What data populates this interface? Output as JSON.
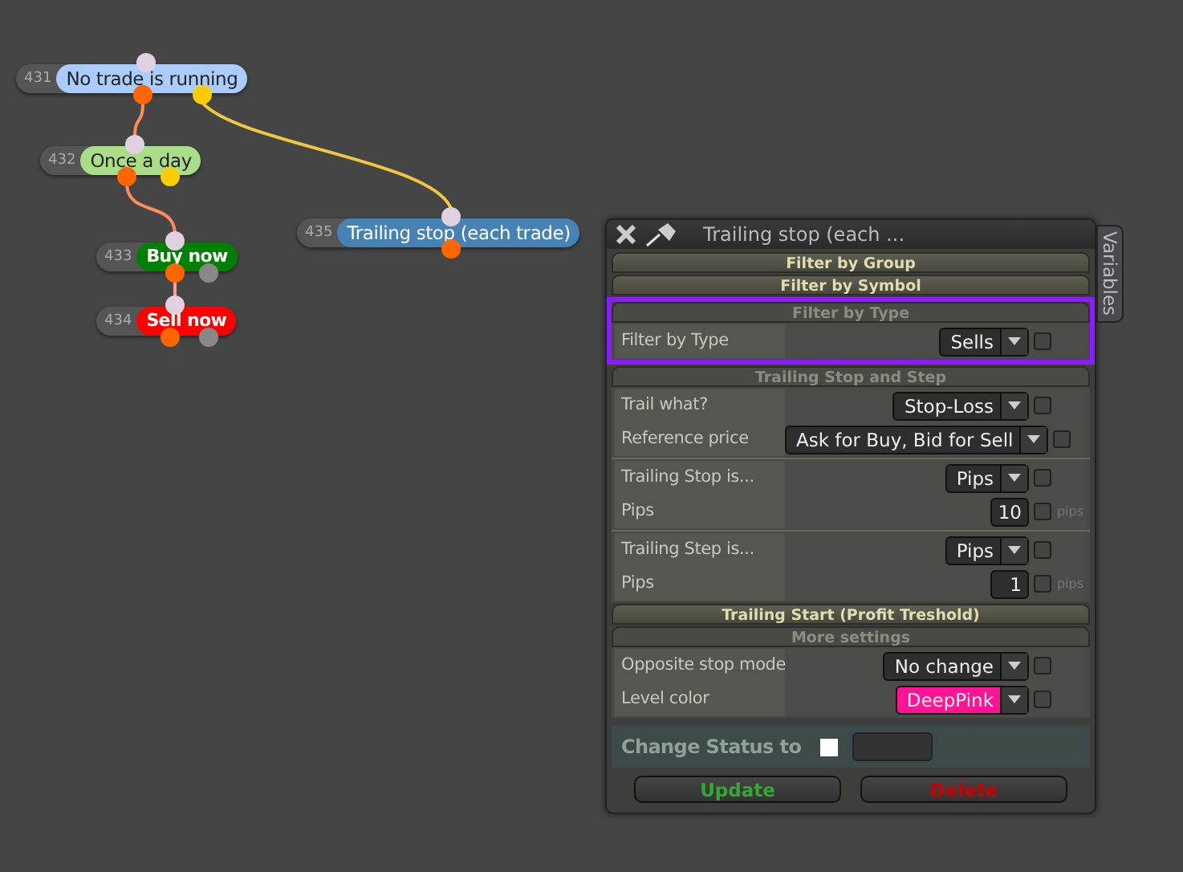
{
  "nodes": [
    {
      "number": "431",
      "label": "No trade is running",
      "color": "#aaccff",
      "outputs": [
        {
          "color": "#ff6600"
        },
        {
          "color": "#ffcc00"
        }
      ]
    },
    {
      "number": "432",
      "label": "Once a day",
      "color": "#aadd88",
      "outputs": [
        {
          "color": "#ff6600"
        },
        {
          "color": "#ffcc00"
        }
      ]
    },
    {
      "number": "433",
      "label": "Buy now",
      "color": "#008000",
      "outputs": [
        {
          "color": "#ff6600"
        },
        {
          "color": "#888888"
        }
      ]
    },
    {
      "number": "434",
      "label": "Sell now",
      "color": "#ff0000",
      "outputs": [
        {
          "color": "#ff6600"
        },
        {
          "color": "#888888"
        }
      ]
    },
    {
      "number": "435",
      "label": "Trailing stop (each trade)",
      "color": "#4682b4",
      "outputs": [
        {
          "color": "#ff6600"
        }
      ]
    }
  ],
  "panel": {
    "title": "Trailing stop (each ...",
    "side_tab": "Variables",
    "sections": [
      {
        "title": "Filter by Group",
        "expanded": false,
        "highlighted": false
      },
      {
        "title": "Filter by Symbol",
        "expanded": false,
        "highlighted": false
      },
      {
        "title": "Filter by Type",
        "expanded": true,
        "highlighted": true,
        "groups": [
          {
            "rows": [
              {
                "kind": "select",
                "label": "Filter by Type",
                "value": "Sells",
                "checked": false
              }
            ]
          }
        ]
      },
      {
        "title": "Trailing Stop and Step",
        "expanded": true,
        "highlighted": false,
        "groups": [
          {
            "rows": [
              {
                "kind": "select",
                "label": "Trail what?",
                "value": "Stop-Loss",
                "checked": false
              },
              {
                "kind": "select",
                "label": "Reference price",
                "value": "Ask for Buy, Bid for Sell",
                "checked": false
              }
            ]
          },
          {
            "rows": [
              {
                "kind": "select",
                "label": "Trailing Stop is...",
                "value": "Pips",
                "checked": false
              },
              {
                "kind": "number",
                "label": "Pips",
                "value": "10",
                "unit": "pips",
                "checked": false
              }
            ]
          },
          {
            "rows": [
              {
                "kind": "select",
                "label": "Trailing Step is...",
                "value": "Pips",
                "checked": false
              },
              {
                "kind": "number",
                "label": "Pips",
                "value": "1",
                "unit": "pips",
                "checked": false
              }
            ]
          }
        ]
      },
      {
        "title": "Trailing Start (Profit Treshold)",
        "expanded": false,
        "highlighted": false
      },
      {
        "title": "More settings",
        "expanded": true,
        "highlighted": false,
        "groups": [
          {
            "rows": [
              {
                "kind": "select",
                "label": "Opposite stop mode",
                "value": "No change",
                "checked": false
              },
              {
                "kind": "select",
                "label": "Level color",
                "value": "DeepPink",
                "color": "#ff1493",
                "checked": false
              }
            ]
          }
        ]
      }
    ],
    "status": {
      "label": "Change Status to",
      "checked": false
    },
    "buttons": [
      {
        "label": "Update",
        "kind": "update"
      },
      {
        "label": "Delete",
        "kind": "delete"
      }
    ]
  }
}
